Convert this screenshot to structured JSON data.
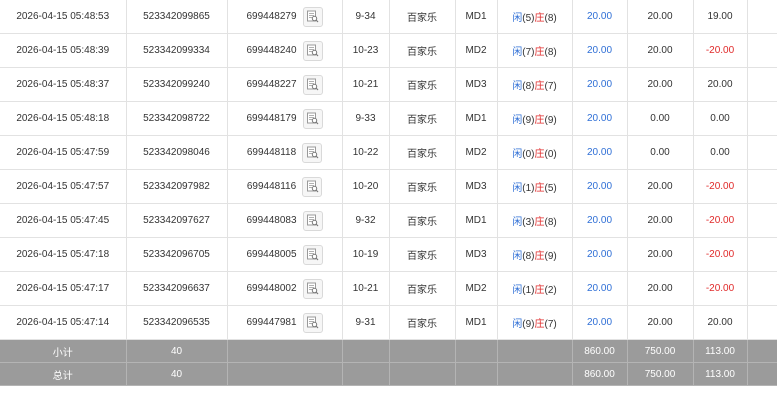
{
  "rows": [
    {
      "time": "2026-04-15 05:48:53",
      "order_id": "523342099865",
      "game_id": "699448279",
      "round": "9-34",
      "game": "百家乐",
      "table": "MD1",
      "xian_label": "闲",
      "xian_score": "(5)",
      "zhuang_label": "庄",
      "zhuang_score": "(8)",
      "bet": "20.00",
      "valid": "20.00",
      "winloss": "19.00",
      "winloss_negative": false
    },
    {
      "time": "2026-04-15 05:48:39",
      "order_id": "523342099334",
      "game_id": "699448240",
      "round": "10-23",
      "game": "百家乐",
      "table": "MD2",
      "xian_label": "闲",
      "xian_score": "(7)",
      "zhuang_label": "庄",
      "zhuang_score": "(8)",
      "bet": "20.00",
      "valid": "20.00",
      "winloss": "-20.00",
      "winloss_negative": true
    },
    {
      "time": "2026-04-15 05:48:37",
      "order_id": "523342099240",
      "game_id": "699448227",
      "round": "10-21",
      "game": "百家乐",
      "table": "MD3",
      "xian_label": "闲",
      "xian_score": "(8)",
      "zhuang_label": "庄",
      "zhuang_score": "(7)",
      "bet": "20.00",
      "valid": "20.00",
      "winloss": "20.00",
      "winloss_negative": false
    },
    {
      "time": "2026-04-15 05:48:18",
      "order_id": "523342098722",
      "game_id": "699448179",
      "round": "9-33",
      "game": "百家乐",
      "table": "MD1",
      "xian_label": "闲",
      "xian_score": "(9)",
      "zhuang_label": "庄",
      "zhuang_score": "(9)",
      "bet": "20.00",
      "valid": "0.00",
      "winloss": "0.00",
      "winloss_negative": false
    },
    {
      "time": "2026-04-15 05:47:59",
      "order_id": "523342098046",
      "game_id": "699448118",
      "round": "10-22",
      "game": "百家乐",
      "table": "MD2",
      "xian_label": "闲",
      "xian_score": "(0)",
      "zhuang_label": "庄",
      "zhuang_score": "(0)",
      "bet": "20.00",
      "valid": "0.00",
      "winloss": "0.00",
      "winloss_negative": false
    },
    {
      "time": "2026-04-15 05:47:57",
      "order_id": "523342097982",
      "game_id": "699448116",
      "round": "10-20",
      "game": "百家乐",
      "table": "MD3",
      "xian_label": "闲",
      "xian_score": "(1)",
      "zhuang_label": "庄",
      "zhuang_score": "(5)",
      "bet": "20.00",
      "valid": "20.00",
      "winloss": "-20.00",
      "winloss_negative": true
    },
    {
      "time": "2026-04-15 05:47:45",
      "order_id": "523342097627",
      "game_id": "699448083",
      "round": "9-32",
      "game": "百家乐",
      "table": "MD1",
      "xian_label": "闲",
      "xian_score": "(3)",
      "zhuang_label": "庄",
      "zhuang_score": "(8)",
      "bet": "20.00",
      "valid": "20.00",
      "winloss": "-20.00",
      "winloss_negative": true
    },
    {
      "time": "2026-04-15 05:47:18",
      "order_id": "523342096705",
      "game_id": "699448005",
      "round": "10-19",
      "game": "百家乐",
      "table": "MD3",
      "xian_label": "闲",
      "xian_score": "(8)",
      "zhuang_label": "庄",
      "zhuang_score": "(9)",
      "bet": "20.00",
      "valid": "20.00",
      "winloss": "-20.00",
      "winloss_negative": true
    },
    {
      "time": "2026-04-15 05:47:17",
      "order_id": "523342096637",
      "game_id": "699448002",
      "round": "10-21",
      "game": "百家乐",
      "table": "MD2",
      "xian_label": "闲",
      "xian_score": "(1)",
      "zhuang_label": "庄",
      "zhuang_score": "(2)",
      "bet": "20.00",
      "valid": "20.00",
      "winloss": "-20.00",
      "winloss_negative": true
    },
    {
      "time": "2026-04-15 05:47:14",
      "order_id": "523342096535",
      "game_id": "699447981",
      "round": "9-31",
      "game": "百家乐",
      "table": "MD1",
      "xian_label": "闲",
      "xian_score": "(9)",
      "zhuang_label": "庄",
      "zhuang_score": "(7)",
      "bet": "20.00",
      "valid": "20.00",
      "winloss": "20.00",
      "winloss_negative": false
    }
  ],
  "subtotal": {
    "label": "小计",
    "count": "40",
    "bet": "860.00",
    "valid": "750.00",
    "winloss": "113.00"
  },
  "total": {
    "label": "总计",
    "count": "40",
    "bet": "860.00",
    "valid": "750.00",
    "winloss": "113.00"
  },
  "icons": {
    "detail": "document-search-icon"
  },
  "colors": {
    "player": "#2f6fd6",
    "banker": "#e02a2a",
    "negative": "#e02a2a",
    "summary_bg": "#9b9b9b"
  }
}
